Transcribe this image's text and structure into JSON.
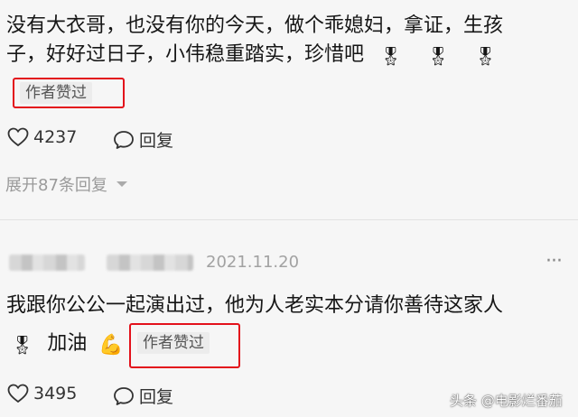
{
  "comment1": {
    "line1": "没有大衣哥，也没有你的今天，做个乖媳妇，拿证，生孩",
    "line2": "子，好好过日子，小伟稳重踏实，珍惜吧",
    "emojis": [
      "🎖",
      "🎖",
      "🎖"
    ],
    "author_liked_tag": "作者赞过",
    "like_count": "4237",
    "reply_label": "回复",
    "expand_label": "展开87条回复"
  },
  "comment2": {
    "date": "2021.11.20",
    "more": "···",
    "line1": "我跟你公公一起演出过，他为人老实本分请你善待这家人",
    "emoji_start": "🎖",
    "line2_text": "加油",
    "emoji_end": "💪",
    "author_liked_tag": "作者赞过",
    "like_count": "3495",
    "reply_label": "回复"
  },
  "watermark": "头条 @电影烂番茄",
  "colors": {
    "highlight_box": "#e3111b",
    "tag_bg": "#ececec",
    "secondary_text": "#9a9a9a"
  }
}
